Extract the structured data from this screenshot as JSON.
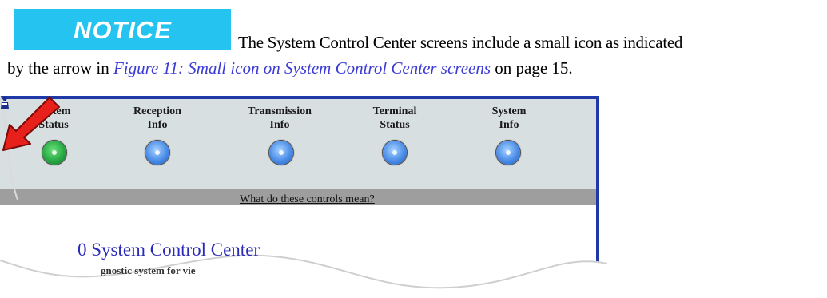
{
  "notice": {
    "label": "NOTICE"
  },
  "paragraph": {
    "line1": "The System Control Center screens include a small icon as indicated",
    "line2_prefix": "by the arrow in ",
    "figure_ref": "Figure 11: Small icon on System Control Center screens",
    "line2_middle": " on page ",
    "page_ref": "15",
    "line2_suffix": "."
  },
  "screenshot": {
    "status_items": [
      {
        "line1": "System",
        "line2": "Status",
        "state": "green"
      },
      {
        "line1": "Reception",
        "line2": "Info",
        "state": "blue"
      },
      {
        "line1": "Transmission",
        "line2": "Info",
        "state": "blue"
      },
      {
        "line1": "Terminal",
        "line2": "Status",
        "state": "blue"
      },
      {
        "line1": "System",
        "line2": "Info",
        "state": "blue"
      }
    ],
    "help_link": "What do these controls mean?",
    "small_icon": "person-help-icon",
    "title_partial": "0 System Control Center",
    "subtitle_partial": "gnostic system for vie",
    "colors": {
      "panel": "#d8dfe1",
      "help_bar": "#9e9e9e",
      "page_frame": "#1f3aa8",
      "arrow": "#e8201c",
      "link_title": "#2a2ab8"
    }
  }
}
